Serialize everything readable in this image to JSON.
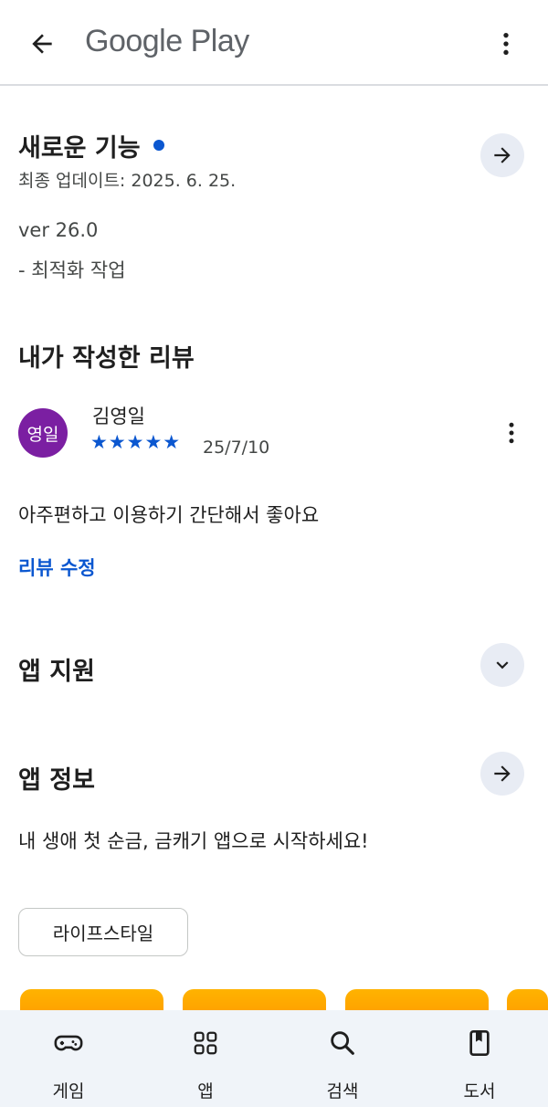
{
  "header": {
    "title": "Google Play",
    "back_icon": "arrow-back-icon",
    "more_icon": "more-vert-icon"
  },
  "whats_new": {
    "title": "새로운 기능",
    "updated": "최종 업데이트: 2025. 6. 25.",
    "version": "ver 26.0",
    "note": "- 최적화 작업"
  },
  "my_review": {
    "title": "내가 작성한 리뷰",
    "avatar_text": "영일",
    "reviewer": "김영일",
    "stars": "★★★★★",
    "rating": 5,
    "date": "25/7/10",
    "text": "아주편하고 이용하기 간단해서 좋아요",
    "edit_label": "리뷰 수정"
  },
  "app_support": {
    "title": "앱 지원"
  },
  "app_info": {
    "title": "앱 정보",
    "description": "내 생애 첫 순금, 금캐기 앱으로 시작하세요!",
    "category_chip": "라이프스타일"
  },
  "bottom_nav": {
    "items": [
      {
        "label": "게임",
        "icon": "gamepad-icon"
      },
      {
        "label": "앱",
        "icon": "apps-grid-icon"
      },
      {
        "label": "검색",
        "icon": "search-icon"
      },
      {
        "label": "도서",
        "icon": "book-icon"
      }
    ]
  },
  "colors": {
    "accent": "#0b57d0",
    "avatar": "#7b1fa2",
    "button_bg": "#e8ecf4",
    "nav_bg": "#f0f4f9",
    "promo": "#ffa000"
  }
}
